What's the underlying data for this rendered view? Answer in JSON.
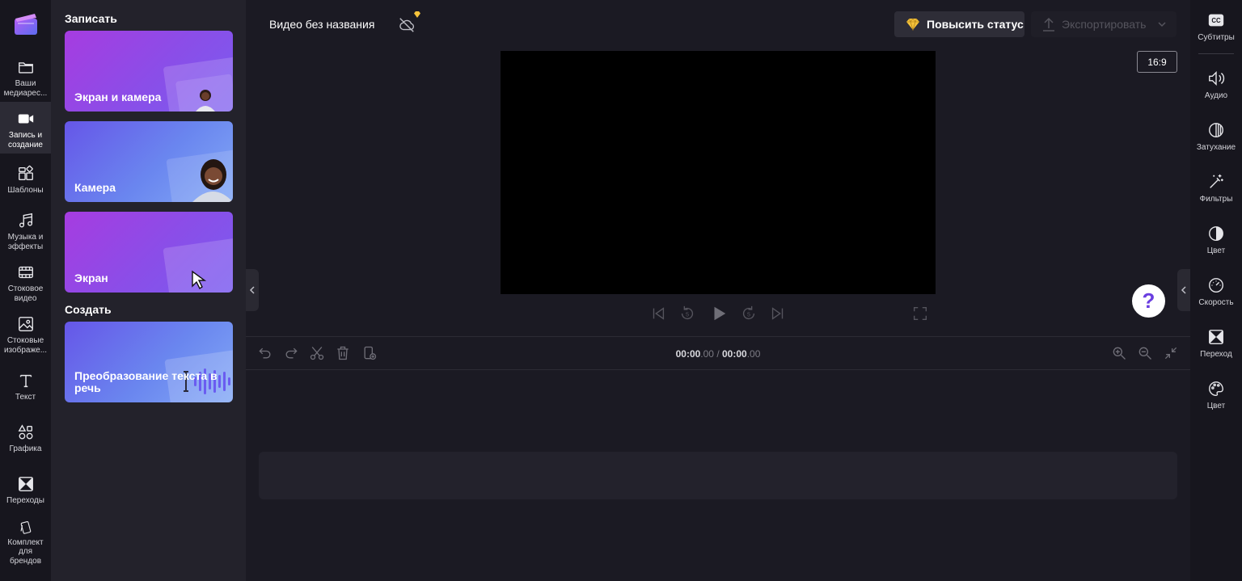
{
  "left_nav": {
    "items": [
      {
        "label": "Ваши медиарес..."
      },
      {
        "label": "Запись и создание"
      },
      {
        "label": "Шаблоны"
      },
      {
        "label": "Музыка и эффекты"
      },
      {
        "label": "Стоковое видео"
      },
      {
        "label": "Стоковые изображе..."
      },
      {
        "label": "Текст"
      },
      {
        "label": "Графика"
      },
      {
        "label": "Переходы"
      },
      {
        "label": "Комплект для брендов"
      }
    ]
  },
  "panel": {
    "record_title": "Записать",
    "create_title": "Создать",
    "cards": [
      {
        "label": "Экран и камера"
      },
      {
        "label": "Камера"
      },
      {
        "label": "Экран"
      },
      {
        "label": "Преобразование текста в речь"
      }
    ]
  },
  "header": {
    "project_title": "Видео без названия",
    "upgrade_label": "Повысить статус",
    "export_label": "Экспортировать",
    "aspect_ratio": "16:9"
  },
  "timeline": {
    "current_main": "00:00",
    "current_frac": ".00",
    "separator": " / ",
    "total_main": "00:00",
    "total_frac": ".00"
  },
  "right_nav": {
    "items": [
      {
        "label": "Субтитры"
      },
      {
        "label": "Аудио"
      },
      {
        "label": "Затухание"
      },
      {
        "label": "Фильтры"
      },
      {
        "label": "Цвет"
      },
      {
        "label": "Скорость"
      },
      {
        "label": "Переход"
      },
      {
        "label": "Цвет"
      }
    ]
  },
  "help": {
    "glyph": "?"
  },
  "colors": {
    "accent": "#7a5cf0",
    "gold": "#f5c33b",
    "background": "#1b1a23",
    "panel": "#23222b"
  }
}
